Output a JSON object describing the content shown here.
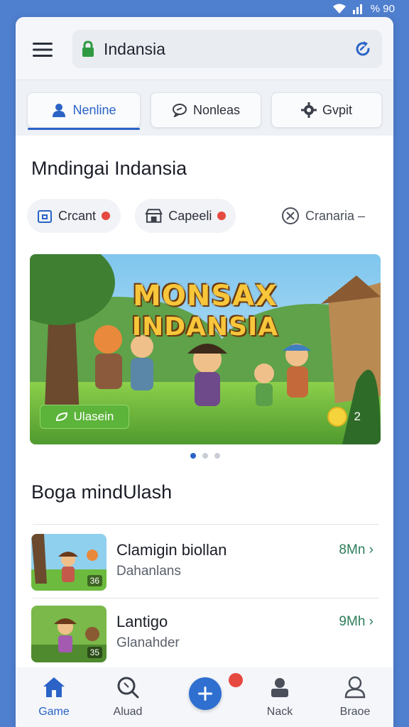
{
  "status_bar": {
    "text": "% 90"
  },
  "top_bar": {
    "url": "Indansia"
  },
  "tabs": [
    {
      "label": "Nenline",
      "icon": "person-icon",
      "active": true
    },
    {
      "label": "Nonleas",
      "icon": "chat-icon",
      "active": false
    },
    {
      "label": "Gvpit",
      "icon": "gear-icon",
      "active": false
    }
  ],
  "section1": {
    "title": "Mndingai Indansia"
  },
  "chips": [
    {
      "label": "Crcant",
      "icon": "box-icon"
    },
    {
      "label": "Capeeli",
      "icon": "store-icon"
    },
    {
      "label": "Cranaria –",
      "icon": "clock-icon"
    }
  ],
  "banner": {
    "title_line1": "MONSAX",
    "title_line2": "INDANSIA",
    "button_label": "Ulasein",
    "count": "2"
  },
  "section2": {
    "title": "Boga mindUlash"
  },
  "list_items": [
    {
      "title": "Clamigin biollan",
      "subtitle": "Dahanlans",
      "size": "8Mn ›",
      "badge": "36"
    },
    {
      "title": "Lantigo",
      "subtitle": "Glanahder",
      "size": "9Mh ›",
      "badge": "35"
    }
  ],
  "bottom_nav": [
    {
      "label": "Game",
      "icon": "home-icon",
      "active": true
    },
    {
      "label": "Aluad",
      "icon": "search-icon",
      "active": false
    },
    {
      "label": "",
      "icon": "plus-icon",
      "active": false
    },
    {
      "label": "Nack",
      "icon": "user-card-icon",
      "active": false
    },
    {
      "label": "Braoe",
      "icon": "profile-icon",
      "active": false
    }
  ],
  "colors": {
    "accent": "#2b63c6",
    "success": "#5cb43a",
    "alert": "#e6493f"
  }
}
